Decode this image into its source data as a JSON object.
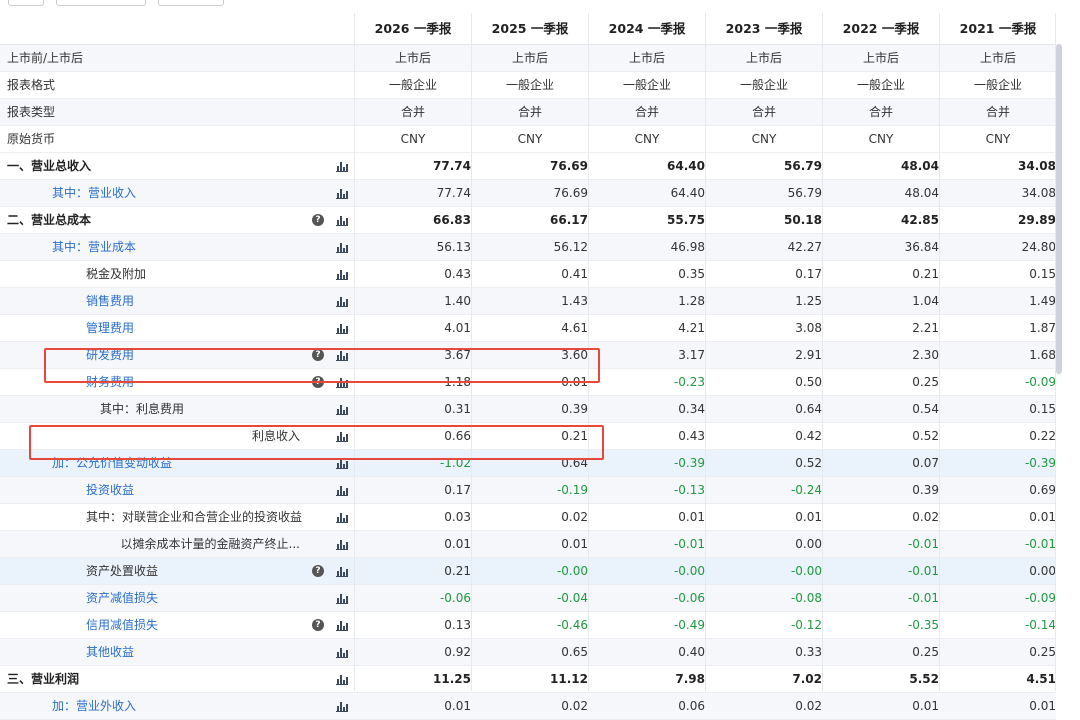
{
  "columns": [
    "2026 一季报",
    "2025 一季报",
    "2024 一季报",
    "2023 一季报",
    "2022 一季报",
    "2021 一季报"
  ],
  "info_rows": [
    {
      "label": "上市前/上市后",
      "values": [
        "上市后",
        "上市后",
        "上市后",
        "上市后",
        "上市后",
        "上市后"
      ]
    },
    {
      "label": "报表格式",
      "values": [
        "一般企业",
        "一般企业",
        "一般企业",
        "一般企业",
        "一般企业",
        "一般企业"
      ]
    },
    {
      "label": "报表类型",
      "values": [
        "合并",
        "合并",
        "合并",
        "合并",
        "合并",
        "合并"
      ]
    },
    {
      "label": "原始货币",
      "values": [
        "CNY",
        "CNY",
        "CNY",
        "CNY",
        "CNY",
        "CNY"
      ]
    }
  ],
  "rows": [
    {
      "label": "一、营业总收入",
      "help": false,
      "values": [
        "77.74",
        "76.69",
        "64.40",
        "56.79",
        "48.04",
        "34.08"
      ]
    },
    {
      "label": "其中：营业收入",
      "help": false,
      "values": [
        "77.74",
        "76.69",
        "64.40",
        "56.79",
        "48.04",
        "34.08"
      ]
    },
    {
      "label": "二、营业总成本",
      "help": true,
      "values": [
        "66.83",
        "66.17",
        "55.75",
        "50.18",
        "42.85",
        "29.89"
      ]
    },
    {
      "label": "其中：营业成本",
      "help": false,
      "values": [
        "56.13",
        "56.12",
        "46.98",
        "42.27",
        "36.84",
        "24.80"
      ]
    },
    {
      "label": "税金及附加",
      "help": false,
      "values": [
        "0.43",
        "0.41",
        "0.35",
        "0.17",
        "0.21",
        "0.15"
      ]
    },
    {
      "label": "销售费用",
      "help": false,
      "values": [
        "1.40",
        "1.43",
        "1.28",
        "1.25",
        "1.04",
        "1.49"
      ]
    },
    {
      "label": "管理费用",
      "help": false,
      "values": [
        "4.01",
        "4.61",
        "4.21",
        "3.08",
        "2.21",
        "1.87"
      ]
    },
    {
      "label": "研发费用",
      "help": true,
      "values": [
        "3.67",
        "3.60",
        "3.17",
        "2.91",
        "2.30",
        "1.68"
      ]
    },
    {
      "label": "财务费用",
      "help": true,
      "values": [
        "1.18",
        "0.01",
        "-0.23",
        "0.50",
        "0.25",
        "-0.09"
      ]
    },
    {
      "label": "其中：利息费用",
      "help": false,
      "values": [
        "0.31",
        "0.39",
        "0.34",
        "0.64",
        "0.54",
        "0.15"
      ]
    },
    {
      "label": "利息收入",
      "help": false,
      "values": [
        "0.66",
        "0.21",
        "0.43",
        "0.42",
        "0.52",
        "0.22"
      ]
    },
    {
      "label": "加：公允价值变动收益",
      "help": false,
      "values": [
        "-1.02",
        "0.64",
        "-0.39",
        "0.52",
        "0.07",
        "-0.39"
      ]
    },
    {
      "label": "投资收益",
      "help": false,
      "values": [
        "0.17",
        "-0.19",
        "-0.13",
        "-0.24",
        "0.39",
        "0.69"
      ]
    },
    {
      "label": "其中：对联营企业和合营企业的投资收益",
      "help": false,
      "values": [
        "0.03",
        "0.02",
        "0.01",
        "0.01",
        "0.02",
        "0.01"
      ]
    },
    {
      "label": "以摊余成本计量的金融资产终止...",
      "help": false,
      "values": [
        "0.01",
        "0.01",
        "-0.01",
        "0.00",
        "-0.01",
        "-0.01"
      ]
    },
    {
      "label": "资产处置收益",
      "help": true,
      "values": [
        "0.21",
        "-0.00",
        "-0.00",
        "-0.00",
        "-0.01",
        "0.00"
      ]
    },
    {
      "label": "资产减值损失",
      "help": false,
      "values": [
        "-0.06",
        "-0.04",
        "-0.06",
        "-0.08",
        "-0.01",
        "-0.09"
      ]
    },
    {
      "label": "信用减值损失",
      "help": true,
      "values": [
        "0.13",
        "-0.46",
        "-0.49",
        "-0.12",
        "-0.35",
        "-0.14"
      ]
    },
    {
      "label": "其他收益",
      "help": false,
      "values": [
        "0.92",
        "0.65",
        "0.40",
        "0.33",
        "0.25",
        "0.25"
      ]
    },
    {
      "label": "三、营业利润",
      "help": false,
      "values": [
        "11.25",
        "11.12",
        "7.98",
        "7.02",
        "5.52",
        "4.51"
      ]
    },
    {
      "label": "加：营业外收入",
      "help": false,
      "values": [
        "0.01",
        "0.02",
        "0.06",
        "0.02",
        "0.01",
        "0.01"
      ]
    }
  ],
  "colors": {
    "accent_blue": "#2a6fc9",
    "negative_green": "#1f9a3f",
    "highlight_red": "#e8473c",
    "row_alt": "#f5f7fb"
  },
  "icons": {
    "chart": "bar-chart-icon",
    "help": "help-icon"
  }
}
